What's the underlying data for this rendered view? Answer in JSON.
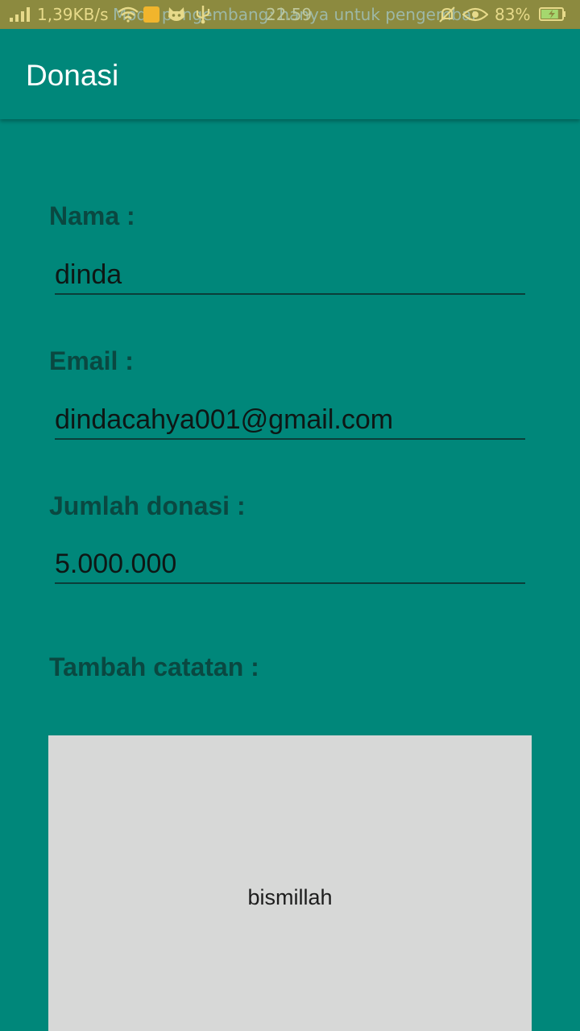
{
  "status_bar": {
    "network_speed": "1,39KB/s",
    "notification_ticker": "Mode pengembang: hanya untuk pengembang",
    "time": "22.59",
    "battery_percent": "83%",
    "battery_level": 0.83,
    "icons": [
      "signal-icon",
      "wifi-icon",
      "lock-icon",
      "cat-face-icon",
      "usb-icon",
      "mute-icon",
      "eye-icon",
      "battery-icon"
    ]
  },
  "app_bar": {
    "title": "Donasi"
  },
  "form": {
    "name_label": "Nama :",
    "name_value": "dinda",
    "email_label": "Email :",
    "email_value": "dindacahya001@gmail.com",
    "amount_label": "Jumlah donasi :",
    "amount_value": "5.000.000",
    "note_label": "Tambah catatan :",
    "note_value": "bismillah"
  },
  "colors": {
    "primary": "#00877A",
    "status_bar": "#8C8A3F",
    "label": "#0A4841",
    "note_background": "#D7D8D7"
  }
}
